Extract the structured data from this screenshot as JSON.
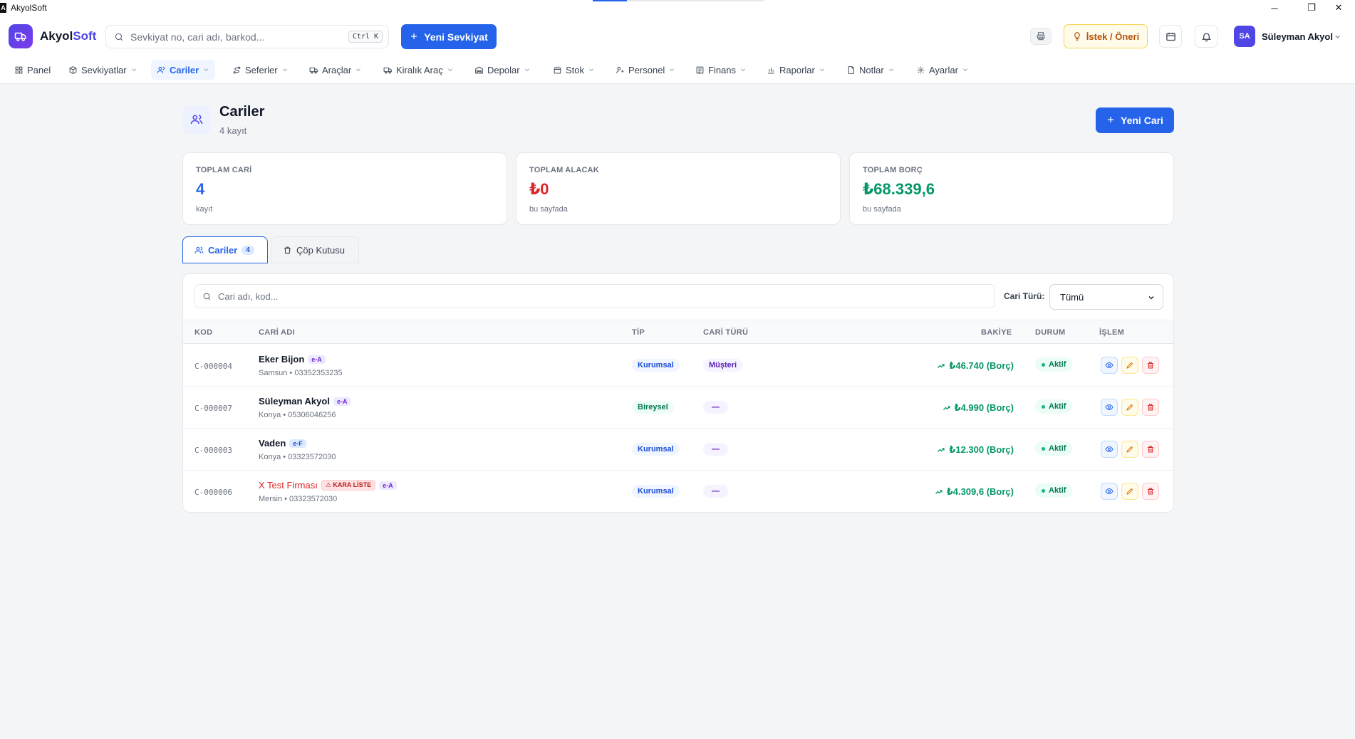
{
  "window": {
    "title": "AkyolSoft",
    "controls": [
      "─",
      "❐",
      "✕"
    ]
  },
  "header": {
    "brand_main": "Akyol",
    "brand_accent": "Soft",
    "search_placeholder": "Sevkiyat no, cari adı, barkod...",
    "search_shortcut": "Ctrl K",
    "new_shipment_label": "Yeni Sevkiyat",
    "suggestion_label": "İstek / Öneri",
    "user_initials": "SA",
    "user_name": "Süleyman Akyol"
  },
  "nav": [
    {
      "label": "Panel",
      "icon": "grid-icon",
      "chevron": false,
      "active": false
    },
    {
      "label": "Sevkiyatlar",
      "icon": "box-icon",
      "chevron": true,
      "active": false
    },
    {
      "label": "Cariler",
      "icon": "users-icon",
      "chevron": true,
      "active": true
    },
    {
      "label": "Seferler",
      "icon": "route-icon",
      "chevron": true,
      "active": false
    },
    {
      "label": "Araçlar",
      "icon": "truck-icon",
      "chevron": true,
      "active": false
    },
    {
      "label": "Kiralık Araç",
      "icon": "rent-truck-icon",
      "chevron": true,
      "active": false
    },
    {
      "label": "Depolar",
      "icon": "warehouse-icon",
      "chevron": true,
      "active": false
    },
    {
      "label": "Stok",
      "icon": "stock-icon",
      "chevron": true,
      "active": false
    },
    {
      "label": "Personel",
      "icon": "person-icon",
      "chevron": true,
      "active": false
    },
    {
      "label": "Finans",
      "icon": "wallet-icon",
      "chevron": true,
      "active": false
    },
    {
      "label": "Raporlar",
      "icon": "chart-icon",
      "chevron": true,
      "active": false
    },
    {
      "label": "Notlar",
      "icon": "note-icon",
      "chevron": true,
      "active": false
    },
    {
      "label": "Ayarlar",
      "icon": "gear-icon",
      "chevron": true,
      "active": false
    }
  ],
  "page": {
    "title": "Cariler",
    "subtitle": "4 kayıt",
    "new_button_label": "Yeni Cari"
  },
  "stats": [
    {
      "label": "TOPLAM CARİ",
      "value": "4",
      "sub": "kayıt",
      "color": "#2563eb"
    },
    {
      "label": "TOPLAM ALACAK",
      "value": "₺0",
      "sub": "bu sayfada",
      "color": "#dc2626"
    },
    {
      "label": "TOPLAM BORÇ",
      "value": "₺68.339,6",
      "sub": "bu sayfada",
      "color": "#059669"
    }
  ],
  "tabs": {
    "active_label": "Cariler",
    "active_count": "4",
    "trash_label": "Çöp Kutusu"
  },
  "filters": {
    "search_placeholder": "Cari adı, kod...",
    "type_label": "Cari Türü:",
    "type_value": "Tümü"
  },
  "table": {
    "headers": {
      "code": "KOD",
      "name": "CARİ ADI",
      "type": "TİP",
      "cari_type": "CARİ TÜRÜ",
      "balance": "BAKİYE",
      "status": "DURUM",
      "actions": "İŞLEM"
    },
    "rows": [
      {
        "code": "C-000004",
        "name": "Eker Bijon",
        "blacklist": "",
        "einv": "e-A",
        "city": "Samsun",
        "phone": "03352353235",
        "type": "Kurumsal",
        "cari_type": "Müşteri",
        "balance": "₺46.740 (Borç)",
        "status": "Aktif"
      },
      {
        "code": "C-000007",
        "name": "Süleyman Akyol",
        "blacklist": "",
        "einv": "e-A",
        "city": "Konya",
        "phone": "05306046256",
        "type": "Bireysel",
        "cari_type": "—",
        "balance": "₺4.990 (Borç)",
        "status": "Aktif"
      },
      {
        "code": "C-000003",
        "name": "Vaden",
        "blacklist": "",
        "einv": "e-F",
        "city": "Konya",
        "phone": "03323572030",
        "type": "Kurumsal",
        "cari_type": "—",
        "balance": "₺12.300 (Borç)",
        "status": "Aktif"
      },
      {
        "code": "C-000006",
        "name": "X Test Firması",
        "blacklist": "KARA LİSTE",
        "einv": "e-A",
        "city": "Mersin",
        "phone": "03323572030",
        "type": "Kurumsal",
        "cari_type": "—",
        "balance": "₺4.309,6 (Borç)",
        "status": "Aktif"
      }
    ]
  }
}
